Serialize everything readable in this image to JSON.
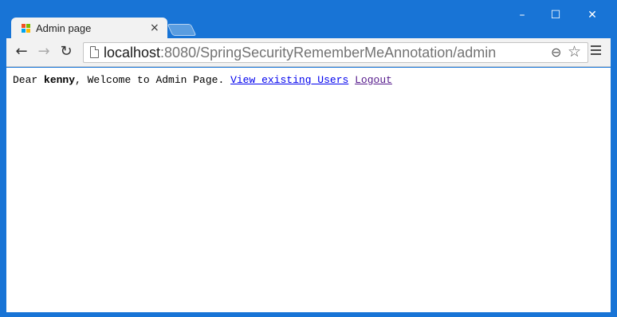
{
  "browser": {
    "tab": {
      "title": "Admin page",
      "close_glyph": "×",
      "favicon": "windows-favicon"
    },
    "window_controls": {
      "minimize": "–",
      "maximize": "☐",
      "close": "✕"
    },
    "nav": {
      "back_glyph": "←",
      "forward_glyph": "→",
      "reload_glyph": "↻"
    },
    "omnibox": {
      "host": "localhost",
      "path": ":8080/SpringSecurityRememberMeAnnotation/admin",
      "zoom_glyph": "⊖",
      "star_glyph": "☆"
    },
    "colors": {
      "frame": "#1874d6",
      "tab": "#f2f2f2",
      "link": "#0000ee",
      "visited_link": "#551a8b"
    }
  },
  "page": {
    "greeting_prefix": "Dear ",
    "username": "kenny",
    "greeting_suffix": ", Welcome to Admin Page. ",
    "view_users_link": "View existing Users",
    "logout_link": "Logout"
  }
}
